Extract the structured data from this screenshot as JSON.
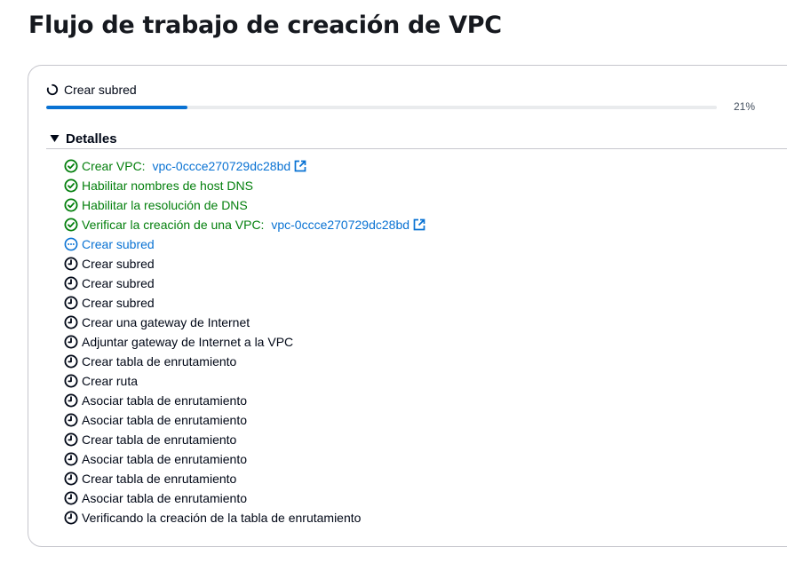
{
  "page": {
    "title": "Flujo de trabajo de creación de VPC"
  },
  "status": {
    "label": "Crear subred",
    "progress_percent": 21,
    "progress_text": "21%"
  },
  "details": {
    "label": "Detalles"
  },
  "steps": [
    {
      "state": "success",
      "text": "Crear VPC: ",
      "link": "vpc-0ccce270729dc28bd"
    },
    {
      "state": "success",
      "text": "Habilitar nombres de host DNS"
    },
    {
      "state": "success",
      "text": "Habilitar la resolución de DNS"
    },
    {
      "state": "success",
      "text": "Verificar la creación de una VPC: ",
      "link": "vpc-0ccce270729dc28bd"
    },
    {
      "state": "in-progress",
      "text": "Crear subred"
    },
    {
      "state": "pending",
      "text": "Crear subred"
    },
    {
      "state": "pending",
      "text": "Crear subred"
    },
    {
      "state": "pending",
      "text": "Crear subred"
    },
    {
      "state": "pending",
      "text": "Crear una gateway de Internet"
    },
    {
      "state": "pending",
      "text": "Adjuntar gateway de Internet a la VPC"
    },
    {
      "state": "pending",
      "text": "Crear tabla de enrutamiento"
    },
    {
      "state": "pending",
      "text": "Crear ruta"
    },
    {
      "state": "pending",
      "text": "Asociar tabla de enrutamiento"
    },
    {
      "state": "pending",
      "text": "Asociar tabla de enrutamiento"
    },
    {
      "state": "pending",
      "text": "Crear tabla de enrutamiento"
    },
    {
      "state": "pending",
      "text": "Asociar tabla de enrutamiento"
    },
    {
      "state": "pending",
      "text": "Crear tabla de enrutamiento"
    },
    {
      "state": "pending",
      "text": "Asociar tabla de enrutamiento"
    },
    {
      "state": "pending",
      "text": "Verificando la creación de la tabla de enrutamiento"
    }
  ],
  "colors": {
    "success": "#037f0c",
    "in_progress": "#0972d3",
    "pending": "#000716",
    "link": "#0972d3",
    "progress_fill": "#0972d3",
    "progress_track": "#e9ebed"
  },
  "icons": {
    "status": "loading-spinner-icon",
    "details_toggle": "caret-down-icon",
    "success": "check-circle-icon",
    "in_progress": "ellipsis-circle-icon",
    "pending": "clock-icon",
    "external_link": "external-link-icon"
  }
}
